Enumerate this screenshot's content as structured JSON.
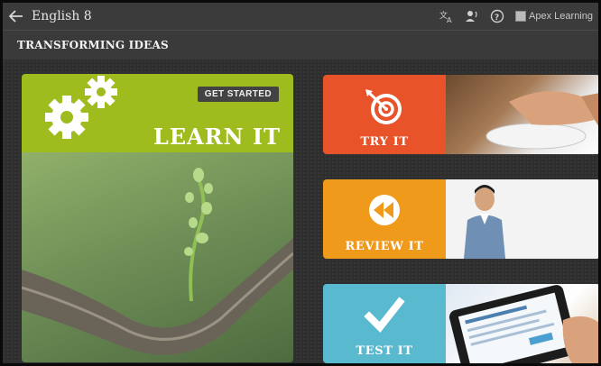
{
  "topbar": {
    "back_icon": "arrow-left-icon",
    "course_title": "English 8",
    "icons": [
      "translate-icon",
      "text-to-speech-icon",
      "help-icon"
    ],
    "brand": "Apex Learning"
  },
  "subbar": {
    "section_title": "TRANSFORMING IDEAS"
  },
  "learn_it": {
    "label": "LEARN IT",
    "get_started": "GET STARTED",
    "icon": "gears-icon",
    "color": "#9fbc1e"
  },
  "actions": [
    {
      "label": "TRY IT",
      "icon": "target-icon",
      "color": "#e8532a"
    },
    {
      "label": "REVIEW IT",
      "icon": "rewind-icon",
      "color": "#ef9a1a"
    },
    {
      "label": "TEST IT",
      "icon": "checkmark-icon",
      "color": "#59b9cf"
    }
  ]
}
